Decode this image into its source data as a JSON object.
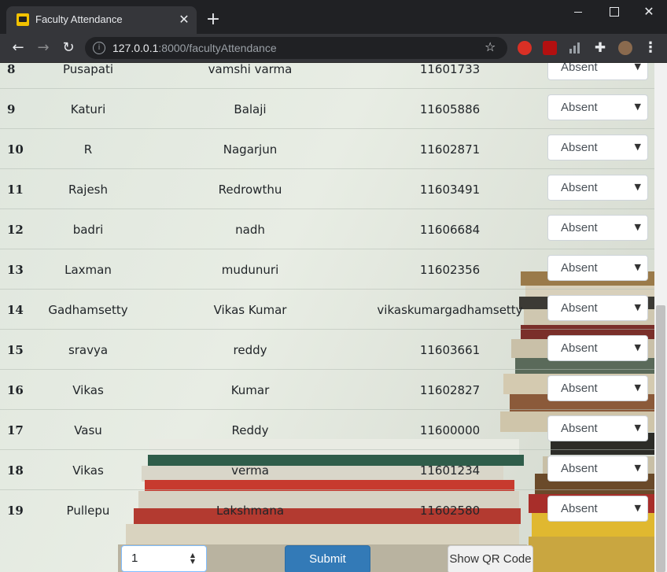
{
  "browser": {
    "tab_title": "Faculty Attendance",
    "tab_close": "✕",
    "new_tab": "+",
    "url_host": "127.0.0.1",
    "url_rest": ":8000/facultyAttendance"
  },
  "table": {
    "rows": [
      {
        "num": "8",
        "first": "Pusapati",
        "last": "vamshi varma",
        "id": "11601733",
        "status": "Absent"
      },
      {
        "num": "9",
        "first": "Katuri",
        "last": "Balaji",
        "id": "11605886",
        "status": "Absent"
      },
      {
        "num": "10",
        "first": "R",
        "last": "Nagarjun",
        "id": "11602871",
        "status": "Absent"
      },
      {
        "num": "11",
        "first": "Rajesh",
        "last": "Redrowthu",
        "id": "11603491",
        "status": "Absent"
      },
      {
        "num": "12",
        "first": "badri",
        "last": "nadh",
        "id": "11606684",
        "status": "Absent"
      },
      {
        "num": "13",
        "first": "Laxman",
        "last": "mudunuri",
        "id": "11602356",
        "status": "Absent"
      },
      {
        "num": "14",
        "first": "Gadhamsetty",
        "last": "Vikas Kumar",
        "id": "vikaskumargadhamsetty",
        "status": "Absent"
      },
      {
        "num": "15",
        "first": "sravya",
        "last": "reddy",
        "id": "11603661",
        "status": "Absent"
      },
      {
        "num": "16",
        "first": "Vikas",
        "last": "Kumar",
        "id": "11602827",
        "status": "Absent"
      },
      {
        "num": "17",
        "first": "Vasu",
        "last": "Reddy",
        "id": "11600000",
        "status": "Absent"
      },
      {
        "num": "18",
        "first": "Vikas",
        "last": "verma",
        "id": "11601234",
        "status": "Absent"
      },
      {
        "num": "19",
        "first": "Pullepu",
        "last": "Lakshmana",
        "id": "11602580",
        "status": "Absent"
      }
    ]
  },
  "form": {
    "number_value": "1",
    "submit_label": "Submit",
    "qr_label": "Show QR Code"
  },
  "colors": {
    "submit_bg": "#337ab7",
    "page_bg": "#dde4dc"
  }
}
